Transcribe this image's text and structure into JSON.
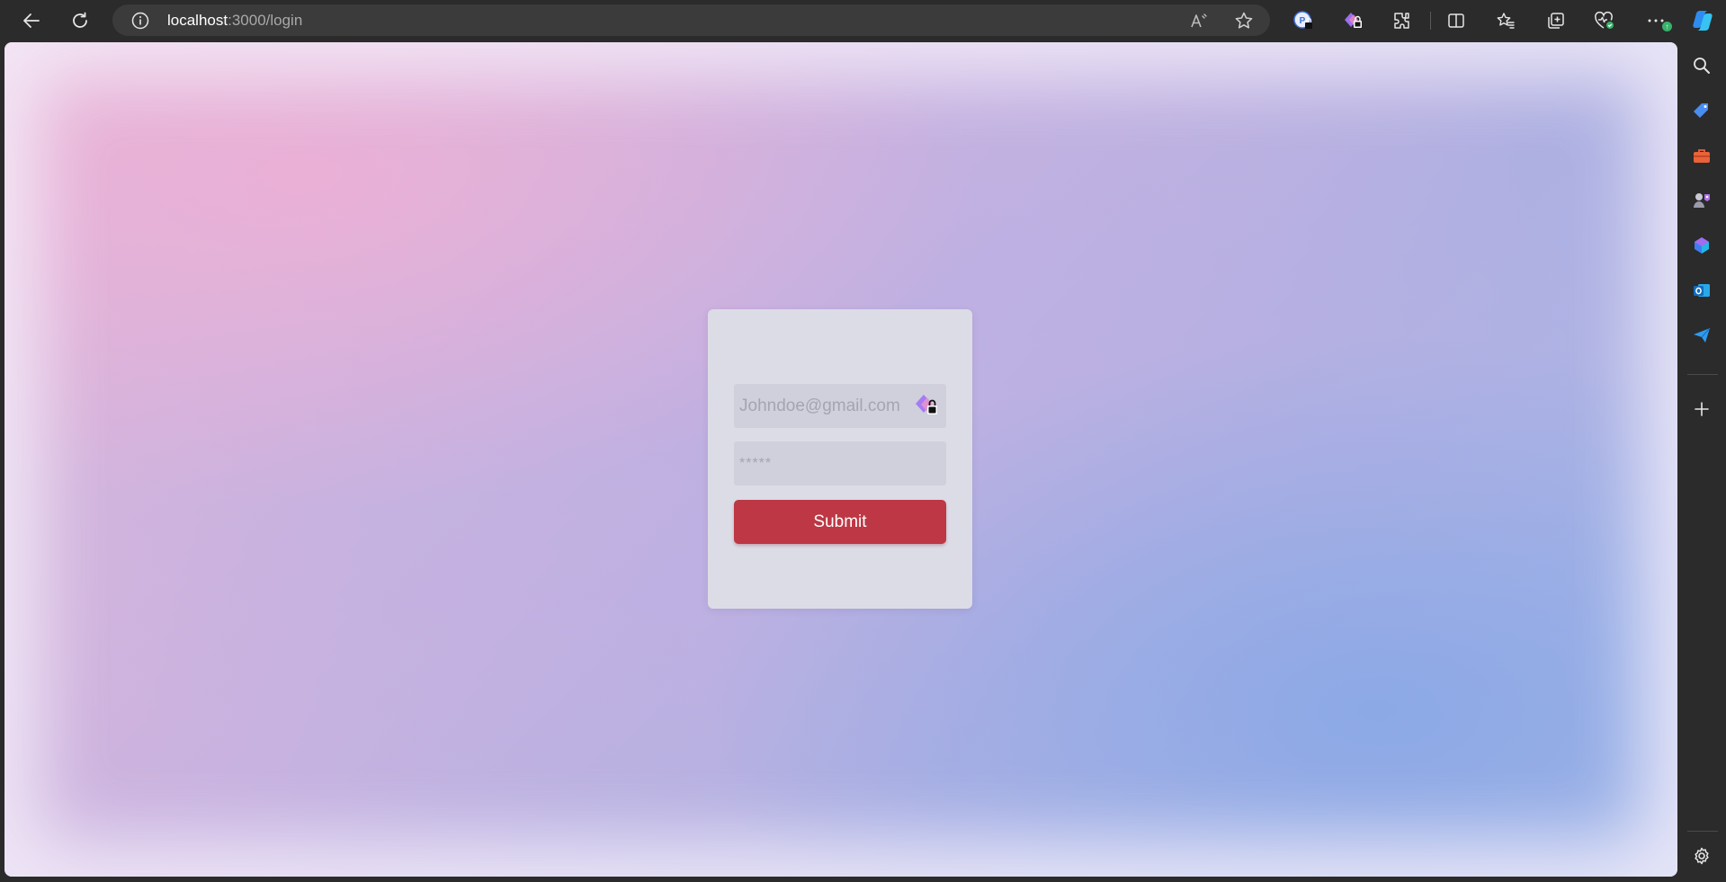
{
  "browser": {
    "url": {
      "host": "localhost",
      "path": ":3000/login"
    },
    "toolbar_icons": [
      "back-icon",
      "refresh-icon",
      "site-info-icon",
      "read-aloud-icon",
      "favorite-star-icon",
      "password-manager-icon",
      "password-lock-icon",
      "extensions-icon",
      "split-screen-icon",
      "favorites-icon",
      "collections-icon",
      "browser-essentials-icon",
      "more-icon",
      "copilot-icon"
    ],
    "more_badge": "↑",
    "sidebar_icons": [
      "search-icon",
      "shopping-icon",
      "tools-icon",
      "games-icon",
      "copilot-sidebar-icon",
      "outlook-icon",
      "send-icon",
      "add-icon",
      "settings-icon"
    ]
  },
  "login": {
    "email_placeholder": "Johndoe@gmail.com",
    "password_placeholder": "*****",
    "submit_label": "Submit"
  },
  "colors": {
    "submit": "#bd3744",
    "card": "#dcdce6",
    "field": "#cfd0dc",
    "browser_chrome": "#2b2b2b"
  }
}
